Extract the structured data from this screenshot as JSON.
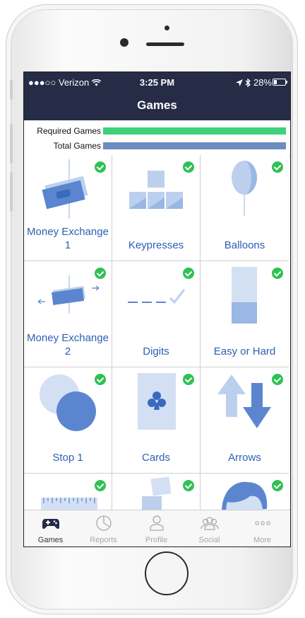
{
  "status_bar": {
    "carrier": "●●●○○ Verizon",
    "time": "3:25 PM",
    "battery": "28%",
    "battery_level": 0.28
  },
  "nav": {
    "title": "Games"
  },
  "progress": {
    "required": {
      "label": "Required Games",
      "value": 1.0,
      "color": "#3ed07a"
    },
    "total": {
      "label": "Total Games",
      "value": 1.0,
      "color": "#6d8cc0"
    }
  },
  "games": [
    {
      "name": "Money Exchange 1",
      "icon": "money-exchange-1-icon",
      "completed": true
    },
    {
      "name": "Keypresses",
      "icon": "keypresses-icon",
      "completed": true
    },
    {
      "name": "Balloons",
      "icon": "balloon-icon",
      "completed": true
    },
    {
      "name": "Money Exchange 2",
      "icon": "money-exchange-2-icon",
      "completed": true
    },
    {
      "name": "Digits",
      "icon": "digits-icon",
      "completed": true
    },
    {
      "name": "Easy or Hard",
      "icon": "easy-or-hard-icon",
      "completed": true
    },
    {
      "name": "Stop 1",
      "icon": "stop-circles-icon",
      "completed": true
    },
    {
      "name": "Cards",
      "icon": "club-card-icon",
      "completed": true
    },
    {
      "name": "Arrows",
      "icon": "arrows-icon",
      "completed": true
    },
    {
      "name": "",
      "icon": "ruler-icon",
      "completed": true
    },
    {
      "name": "",
      "icon": "squares-icon",
      "completed": true
    },
    {
      "name": "",
      "icon": "face-icon",
      "completed": true
    }
  ],
  "tabs": [
    {
      "label": "Games",
      "icon": "gamepad-icon",
      "active": true
    },
    {
      "label": "Reports",
      "icon": "pie-chart-icon",
      "active": false
    },
    {
      "label": "Profile",
      "icon": "person-icon",
      "active": false
    },
    {
      "label": "Social",
      "icon": "group-icon",
      "active": false
    },
    {
      "label": "More",
      "icon": "more-dots-icon",
      "active": false
    }
  ],
  "colors": {
    "header_bg": "#262b46",
    "accent_blue": "#2c5fb3",
    "check_green": "#2fc153"
  }
}
